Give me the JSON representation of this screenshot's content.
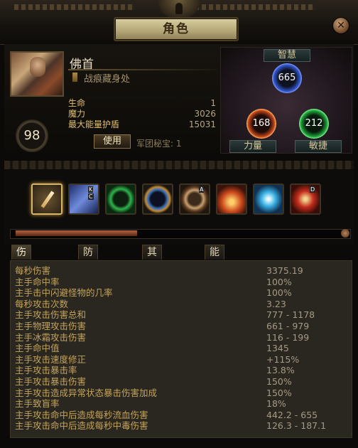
{
  "window": {
    "title": "角色"
  },
  "character": {
    "name": "佛首",
    "subtitle": "战痕藏身处",
    "level": "98",
    "stats": [
      {
        "label": "生命",
        "value": "1"
      },
      {
        "label": "魔力",
        "value": "3026"
      },
      {
        "label": "最大能量护盾",
        "value": "15031"
      }
    ],
    "use_button": "使用",
    "legion": "军团秘宝: 1"
  },
  "attributes": {
    "int": {
      "label": "智慧",
      "value": "665"
    },
    "str": {
      "label": "力量",
      "value": "168"
    },
    "dex": {
      "label": "敏捷",
      "value": "212"
    },
    "colors": {
      "int": "#2e54c9",
      "str": "#c2451c",
      "dex": "#1fa53a"
    }
  },
  "gems": {
    "tags": [
      "K",
      "C",
      "A",
      "D"
    ],
    "experience_fraction": 0.38
  },
  "tabs": [
    "伤害属性",
    "防御属性",
    "其他属性",
    "能量球"
  ],
  "damage_stats": [
    {
      "k": "每秒伤害",
      "v": "3375.19"
    },
    {
      "k": "主手命中率",
      "v": "100%"
    },
    {
      "k": "主手击中闪避怪物的几率",
      "v": "100%"
    },
    {
      "k": "每秒攻击次数",
      "v": "3.23"
    },
    {
      "k": "主手攻击伤害总和",
      "v": "777 - 1178"
    },
    {
      "k": "主手物理攻击伤害",
      "v": "661 - 979"
    },
    {
      "k": "主手冰霜攻击伤害",
      "v": "116 - 199"
    },
    {
      "k": "主手命中值",
      "v": "1345"
    },
    {
      "k": "主手攻击速度修正",
      "v": "+115%"
    },
    {
      "k": "主手攻击暴击率",
      "v": "13.8%"
    },
    {
      "k": "主手攻击暴击伤害",
      "v": "150%"
    },
    {
      "k": "主手攻击造成异常状态暴击伤害加成",
      "v": "150%"
    },
    {
      "k": "主手致盲率",
      "v": "18%"
    },
    {
      "k": "主手攻击命中后造成每秒流血伤害",
      "v": "442.2 - 655"
    },
    {
      "k": "主手攻击命中后造成每秒中毒伤害",
      "v": "126.3 - 187.1"
    }
  ]
}
